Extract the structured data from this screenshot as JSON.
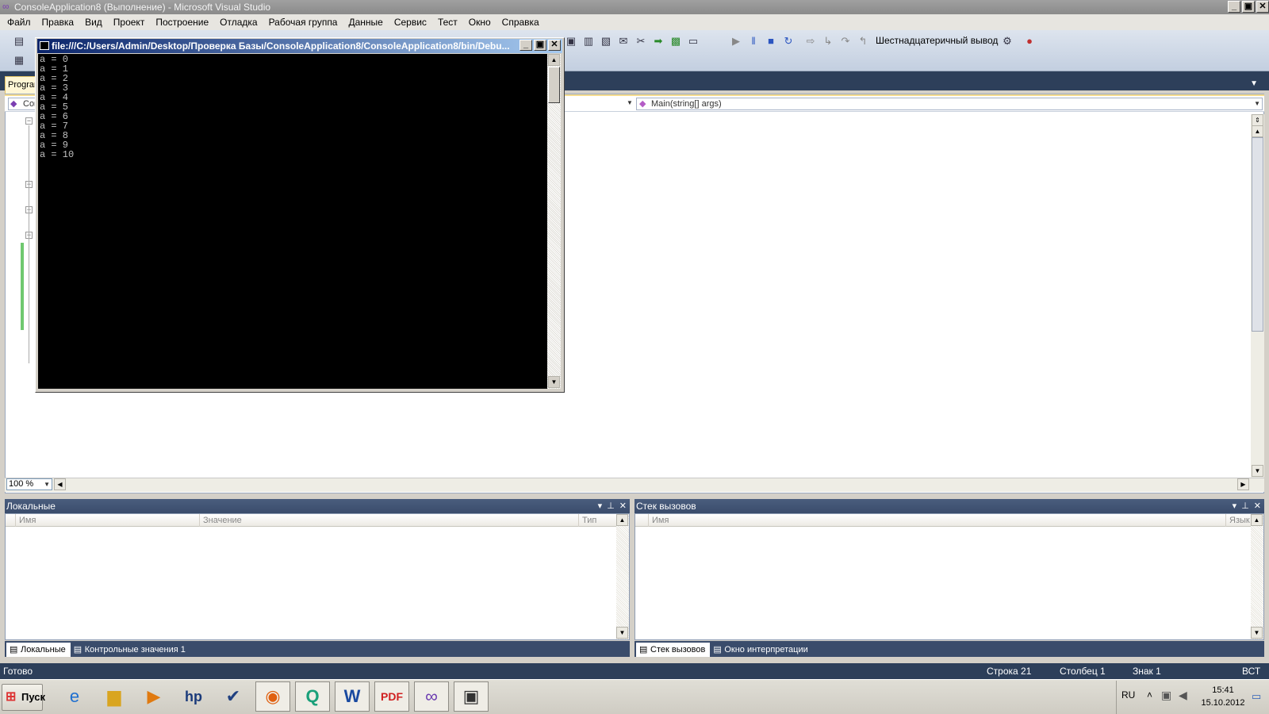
{
  "window": {
    "title": "ConsoleApplication8 (Выполнение) - Microsoft Visual Studio",
    "min_glyph": "_",
    "max_glyph": "▣",
    "close_glyph": "✕"
  },
  "menu": [
    "Файл",
    "Правка",
    "Вид",
    "Проект",
    "Построение",
    "Отладка",
    "Рабочая группа",
    "Данные",
    "Сервис",
    "Тест",
    "Окно",
    "Справка"
  ],
  "toolbar": {
    "hex_label": "Шестнадцатеричный вывод"
  },
  "editor": {
    "doc_tab": "Program.cs",
    "nav_left": "ConsoleApplication8.Program",
    "nav_right": "Main(string[] args)",
    "zoom": "100 %"
  },
  "console": {
    "title": "file:///C:/Users/Admin/Desktop/Проверка Базы/ConsoleApplication8/ConsoleApplication8/bin/Debu...",
    "output": "a = 0\na = 1\na = 2\na = 3\na = 4\na = 5\na = 6\na = 7\na = 8\na = 9\na = 10"
  },
  "locals_pane": {
    "title": "Локальные",
    "columns": [
      "Имя",
      "Значение",
      "Тип"
    ]
  },
  "callstack_pane": {
    "title": "Стек вызовов",
    "columns": [
      "Имя",
      "Язык"
    ]
  },
  "bottom_tabs_left": [
    "Локальные",
    "Контрольные значения 1"
  ],
  "bottom_tabs_right": [
    "Стек вызовов",
    "Окно интерпретации"
  ],
  "status": {
    "ready": "Готово",
    "line": "Строка 21",
    "col": "Столбец 1",
    "char": "Знак 1",
    "mode": "ВСТ"
  },
  "taskbar": {
    "start": "Пуск",
    "apps": [
      "internet-explorer-icon",
      "folder-icon",
      "media-player-icon",
      "hp-icon",
      "task-check-icon",
      "firefox-icon",
      "q-app-icon",
      "word-icon",
      "pdf-icon",
      "visual-studio-icon",
      "console-icon"
    ],
    "lang": "RU",
    "time": "15:41",
    "date": "15.10.2012"
  }
}
